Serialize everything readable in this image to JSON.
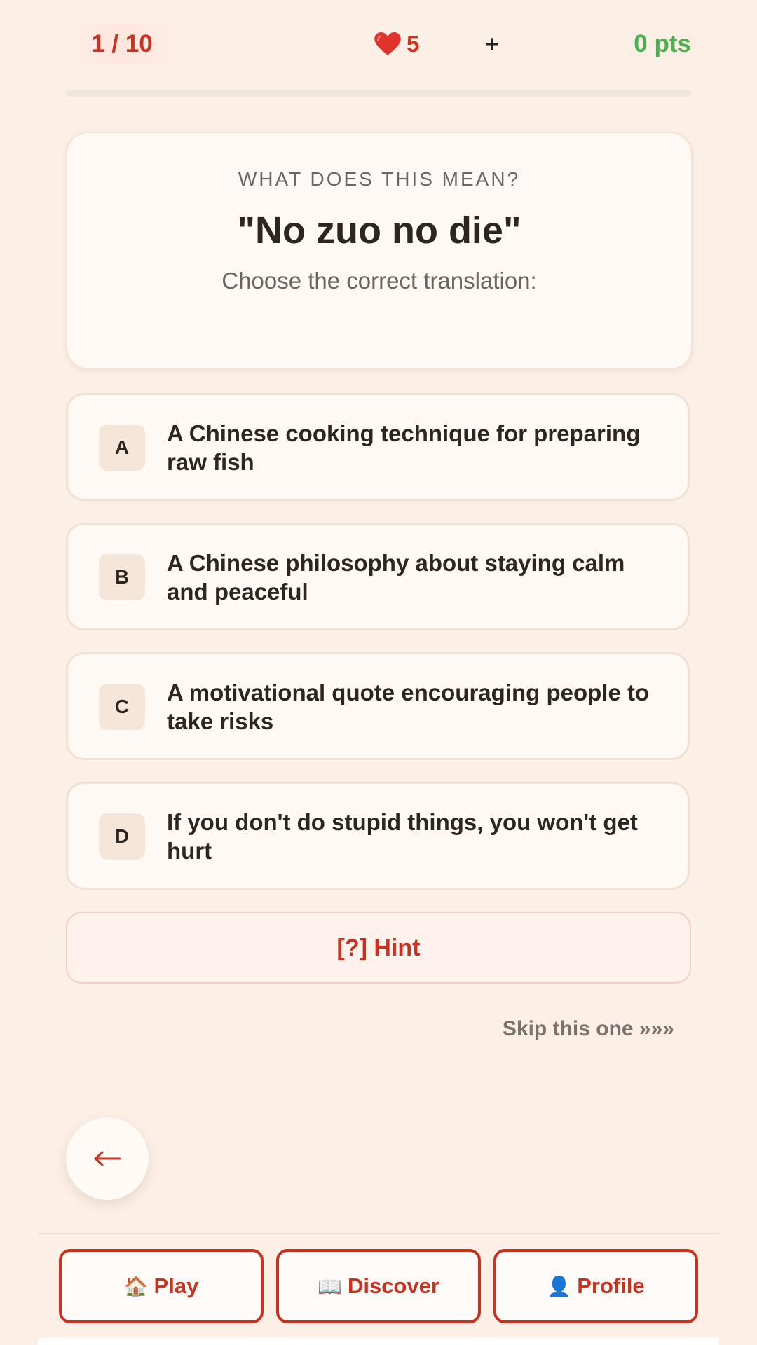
{
  "header": {
    "progress_text": "1 / 10",
    "progress_fraction": 0,
    "lives_icon": "heart-icon",
    "lives": "5",
    "plus_label": "+",
    "points": "0 pts"
  },
  "question": {
    "label": "WHAT DOES THIS MEAN?",
    "phrase": "\"No zuo no die\"",
    "instruction": "Choose the correct translation:"
  },
  "options": [
    {
      "letter": "A",
      "text": "A Chinese cooking technique for preparing raw fish"
    },
    {
      "letter": "B",
      "text": "A Chinese philosophy about staying calm and peaceful"
    },
    {
      "letter": "C",
      "text": "A motivational quote encouraging people to take risks"
    },
    {
      "letter": "D",
      "text": "If you don't do stupid things, you won't get hurt"
    }
  ],
  "hint_label": "[?] Hint",
  "skip_label": "Skip this one »»»",
  "back": {
    "icon": "back-arrow-icon"
  },
  "nav": {
    "play": {
      "icon": "🏠",
      "label": "Play"
    },
    "discover": {
      "icon": "📖",
      "label": "Discover"
    },
    "profile": {
      "icon": "👤",
      "label": "Profile"
    }
  },
  "colors": {
    "accent": "#c8321f",
    "points_green": "#4caf50",
    "background": "#fcefe5"
  }
}
